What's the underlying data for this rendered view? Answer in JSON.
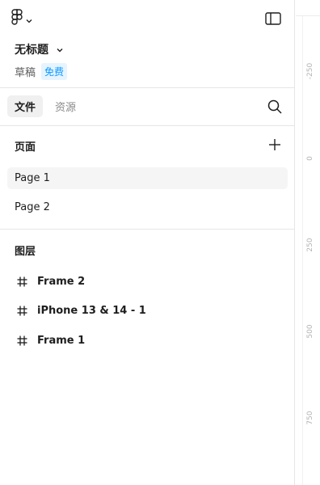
{
  "file": {
    "title": "无标题",
    "status": "草稿",
    "plan": "免费"
  },
  "tabs": [
    {
      "label": "文件",
      "active": true
    },
    {
      "label": "资源",
      "active": false
    }
  ],
  "pages": {
    "section_title": "页面",
    "items": [
      {
        "label": "Page 1",
        "selected": true
      },
      {
        "label": "Page 2",
        "selected": false
      }
    ]
  },
  "layers": {
    "section_title": "图层",
    "items": [
      {
        "label": "Frame 2",
        "icon": "frame-icon"
      },
      {
        "label": "iPhone 13 & 14 - 1",
        "icon": "frame-icon"
      },
      {
        "label": "Frame 1",
        "icon": "frame-icon"
      }
    ]
  },
  "ruler": {
    "ticks": [
      "-250",
      "0",
      "250",
      "500",
      "750"
    ]
  },
  "colors": {
    "badge_bg": "#e5f4ff",
    "badge_text": "#0d99ff",
    "selected_bg": "#f5f5f5",
    "active_tab_bg": "#f0f0f0"
  }
}
